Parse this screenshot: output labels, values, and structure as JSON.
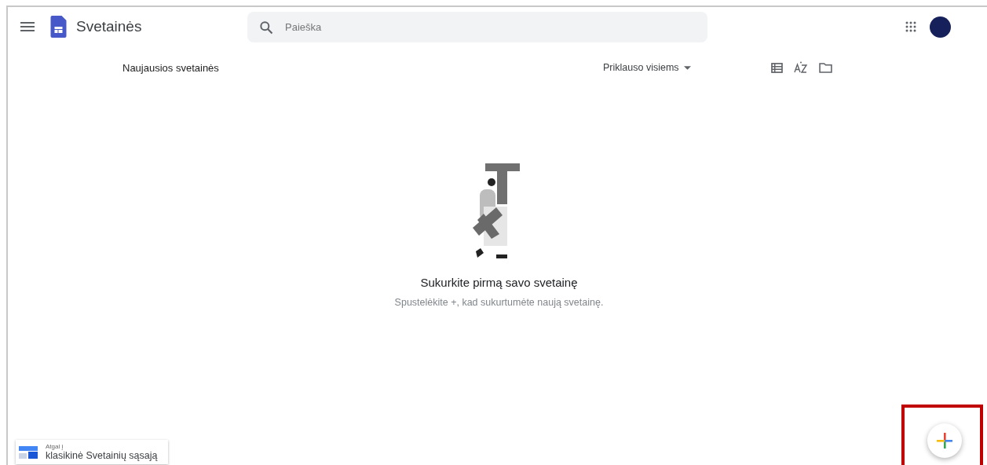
{
  "app_bar": {
    "title": "Svetainės",
    "search": {
      "placeholder": "Paieška"
    }
  },
  "toolbar": {
    "heading": "Naujausios svetainės",
    "owner_filter": "Priklauso visiems"
  },
  "empty_state": {
    "title": "Sukurkite pirmą savo svetainę",
    "hint": "Spustelėkite +, kad sukurtumėte naują svetainę."
  },
  "classic_link": {
    "line_1": "Atgal į",
    "line_2": "klasikinė Svetainių sąsają"
  }
}
